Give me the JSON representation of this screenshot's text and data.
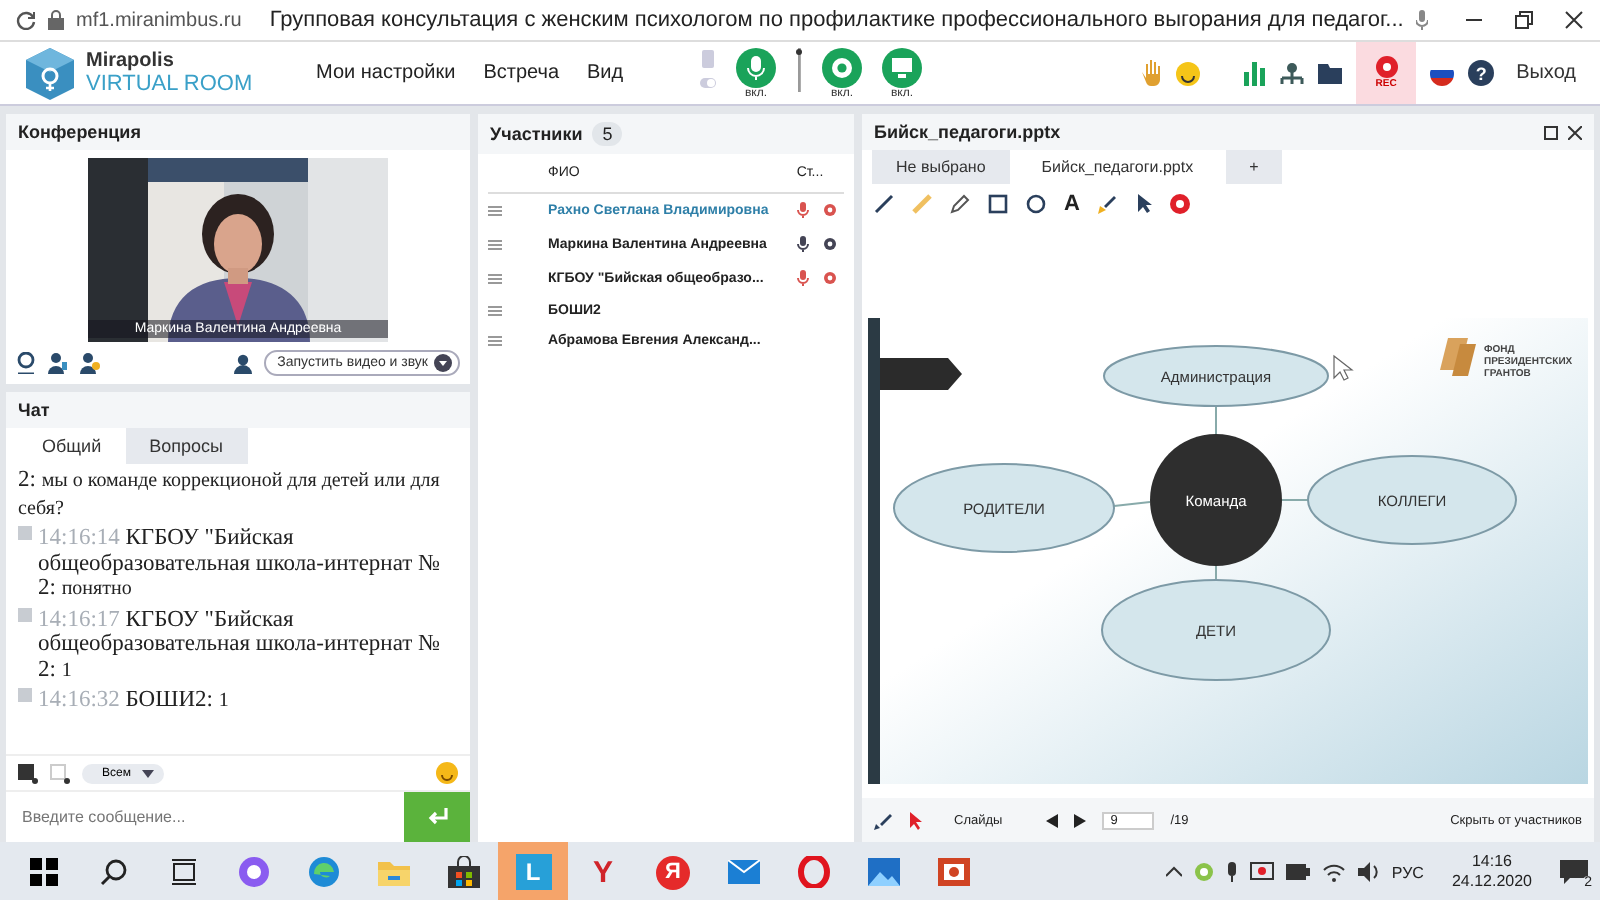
{
  "browser": {
    "url": "mf1.miranimbus.ru",
    "title": "Групповая консультация с женским психологом по профилактике профессионального выгорания для педагог..."
  },
  "header": {
    "logo": {
      "name": "Mirapolis",
      "subtitle": "VIRTUAL ROOM"
    },
    "menu": [
      "Мои настройки",
      "Встреча",
      "Вид"
    ],
    "media_buttons": [
      {
        "kind": "mic",
        "label": "вкл."
      },
      {
        "kind": "camera",
        "label": "вкл."
      },
      {
        "kind": "screen",
        "label": "вкл."
      }
    ],
    "rec": {
      "label": "REC",
      "on": true
    },
    "help": "?",
    "exit": "Выход"
  },
  "conference": {
    "title": "Конференция",
    "video": {
      "kind": "picture",
      "caption": "Маркина Валентина Андреевна"
    },
    "start_button": "Запустить видео и звук"
  },
  "chat": {
    "title": "Чат",
    "tabs": [
      {
        "label": "Общий",
        "selected": true
      },
      {
        "label": "Вопросы",
        "selected": false
      }
    ],
    "messages": [
      {
        "author": "2:",
        "text": "мы о команде коррекционой для детей или для себя?"
      },
      {
        "time": "14:16:14",
        "author": "КГБОУ \"Бийская общеобразовательная школа-интернат № 2:",
        "text": "понятно"
      },
      {
        "time": "14:16:17",
        "author": "КГБОУ \"Бийская общеобразовательная школа-интернат № 2:",
        "text": "1"
      },
      {
        "time": "14:16:32",
        "author": "БОШИ2:",
        "text": "1"
      }
    ],
    "recipient": "Всем",
    "input": {
      "placeholder": "Введите сообщение..."
    }
  },
  "participants": {
    "title": "Участники",
    "count": "5",
    "columns": [
      "ФИО",
      "Ст..."
    ],
    "rows": [
      {
        "name": "Рахно Светлана  Владимировна",
        "highlighted": true,
        "mic_on": false,
        "camera_on": false
      },
      {
        "name": "Маркина Валентина  Андреевна",
        "highlighted": false,
        "mic_on": true,
        "camera_on": true
      },
      {
        "name": "КГБОУ \"Бийская общеобразо...",
        "highlighted": false,
        "mic_on": false,
        "camera_on": false
      },
      {
        "name": "БОШИ2",
        "highlighted": false
      },
      {
        "name": "Абрамова  Евгения  Александ...",
        "highlighted": false
      }
    ]
  },
  "presentation": {
    "title": "Бийск_педагоги.pptx",
    "tabs": [
      {
        "label": "Не выбрано",
        "selected": false
      },
      {
        "label": "Бийск_педагоги.pptx",
        "selected": true
      },
      {
        "label": "+",
        "selected": false
      }
    ],
    "text_tool": "A",
    "slide": {
      "nodes": [
        {
          "kind": "ellipse",
          "text": "Администрация"
        },
        {
          "kind": "circle",
          "text": "Команда"
        },
        {
          "kind": "ellipse",
          "text": "РОДИТЕЛИ"
        },
        {
          "kind": "ellipse",
          "text": "КОЛЛЕГИ"
        },
        {
          "kind": "ellipse",
          "text": "ДЕТИ"
        }
      ],
      "logo_lines": [
        "ФОНД",
        "ПРЕЗИДЕНТСКИХ",
        "ГРАНТОВ"
      ]
    },
    "footer": {
      "slides_label": "Слайды",
      "page": "9",
      "total": "/19",
      "hide": "Скрыть от участников"
    }
  },
  "taskbar": {
    "apps": [
      {
        "kind": "start"
      },
      {
        "kind": "search"
      },
      {
        "kind": "taskview"
      },
      {
        "kind": "alice"
      },
      {
        "kind": "edge"
      },
      {
        "kind": "folder"
      },
      {
        "kind": "store"
      },
      {
        "kind": "tile",
        "glyph": "L",
        "selected": true
      },
      {
        "kind": "letter",
        "glyph": "Y",
        "selected": false
      },
      {
        "kind": "badge",
        "glyph": "Я",
        "selected": false
      },
      {
        "kind": "mail"
      },
      {
        "kind": "opera"
      },
      {
        "kind": "photos"
      },
      {
        "kind": "slides"
      }
    ],
    "language": "РУС",
    "time": "14:16",
    "date": "24.12.2020",
    "notifications": "2"
  }
}
